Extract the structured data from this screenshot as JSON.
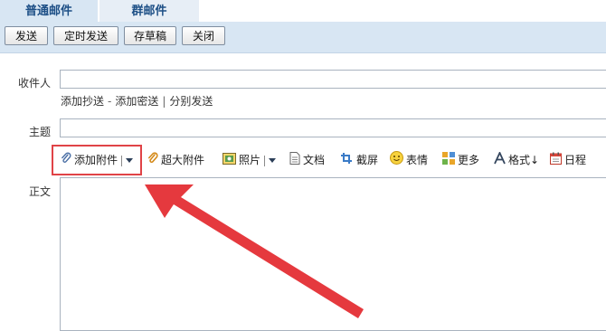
{
  "tabs": [
    {
      "label": "普通邮件",
      "active": true
    },
    {
      "label": "群邮件",
      "active": false
    }
  ],
  "actions": {
    "send": "发送",
    "timed_send": "定时发送",
    "save_draft": "存草稿",
    "close": "关闭"
  },
  "form": {
    "to_label": "收件人",
    "to_value": "",
    "add_cc": "添加抄送",
    "dash": "-",
    "add_bcc": "添加密送",
    "divider": "|",
    "separate_send": "分别发送",
    "subject_label": "主题",
    "subject_value": "",
    "body_label": "正文"
  },
  "toolbar": {
    "attach": "添加附件",
    "large_attach": "超大附件",
    "photo": "照片",
    "document": "文档",
    "screenshot": "截屏",
    "emoji": "表情",
    "more": "更多",
    "format": "格式",
    "format_suffix": "↓",
    "schedule": "日程"
  },
  "icons": [
    "paperclip-icon",
    "large-paperclip-icon",
    "photo-icon",
    "document-icon",
    "scissors-icon",
    "emoji-icon",
    "more-grid-icon",
    "format-a-icon",
    "calendar-icon"
  ],
  "colors": {
    "accent_blue": "#1d4f86",
    "tab_bg": "#d8e6f3",
    "annotation_red": "#e04347"
  }
}
